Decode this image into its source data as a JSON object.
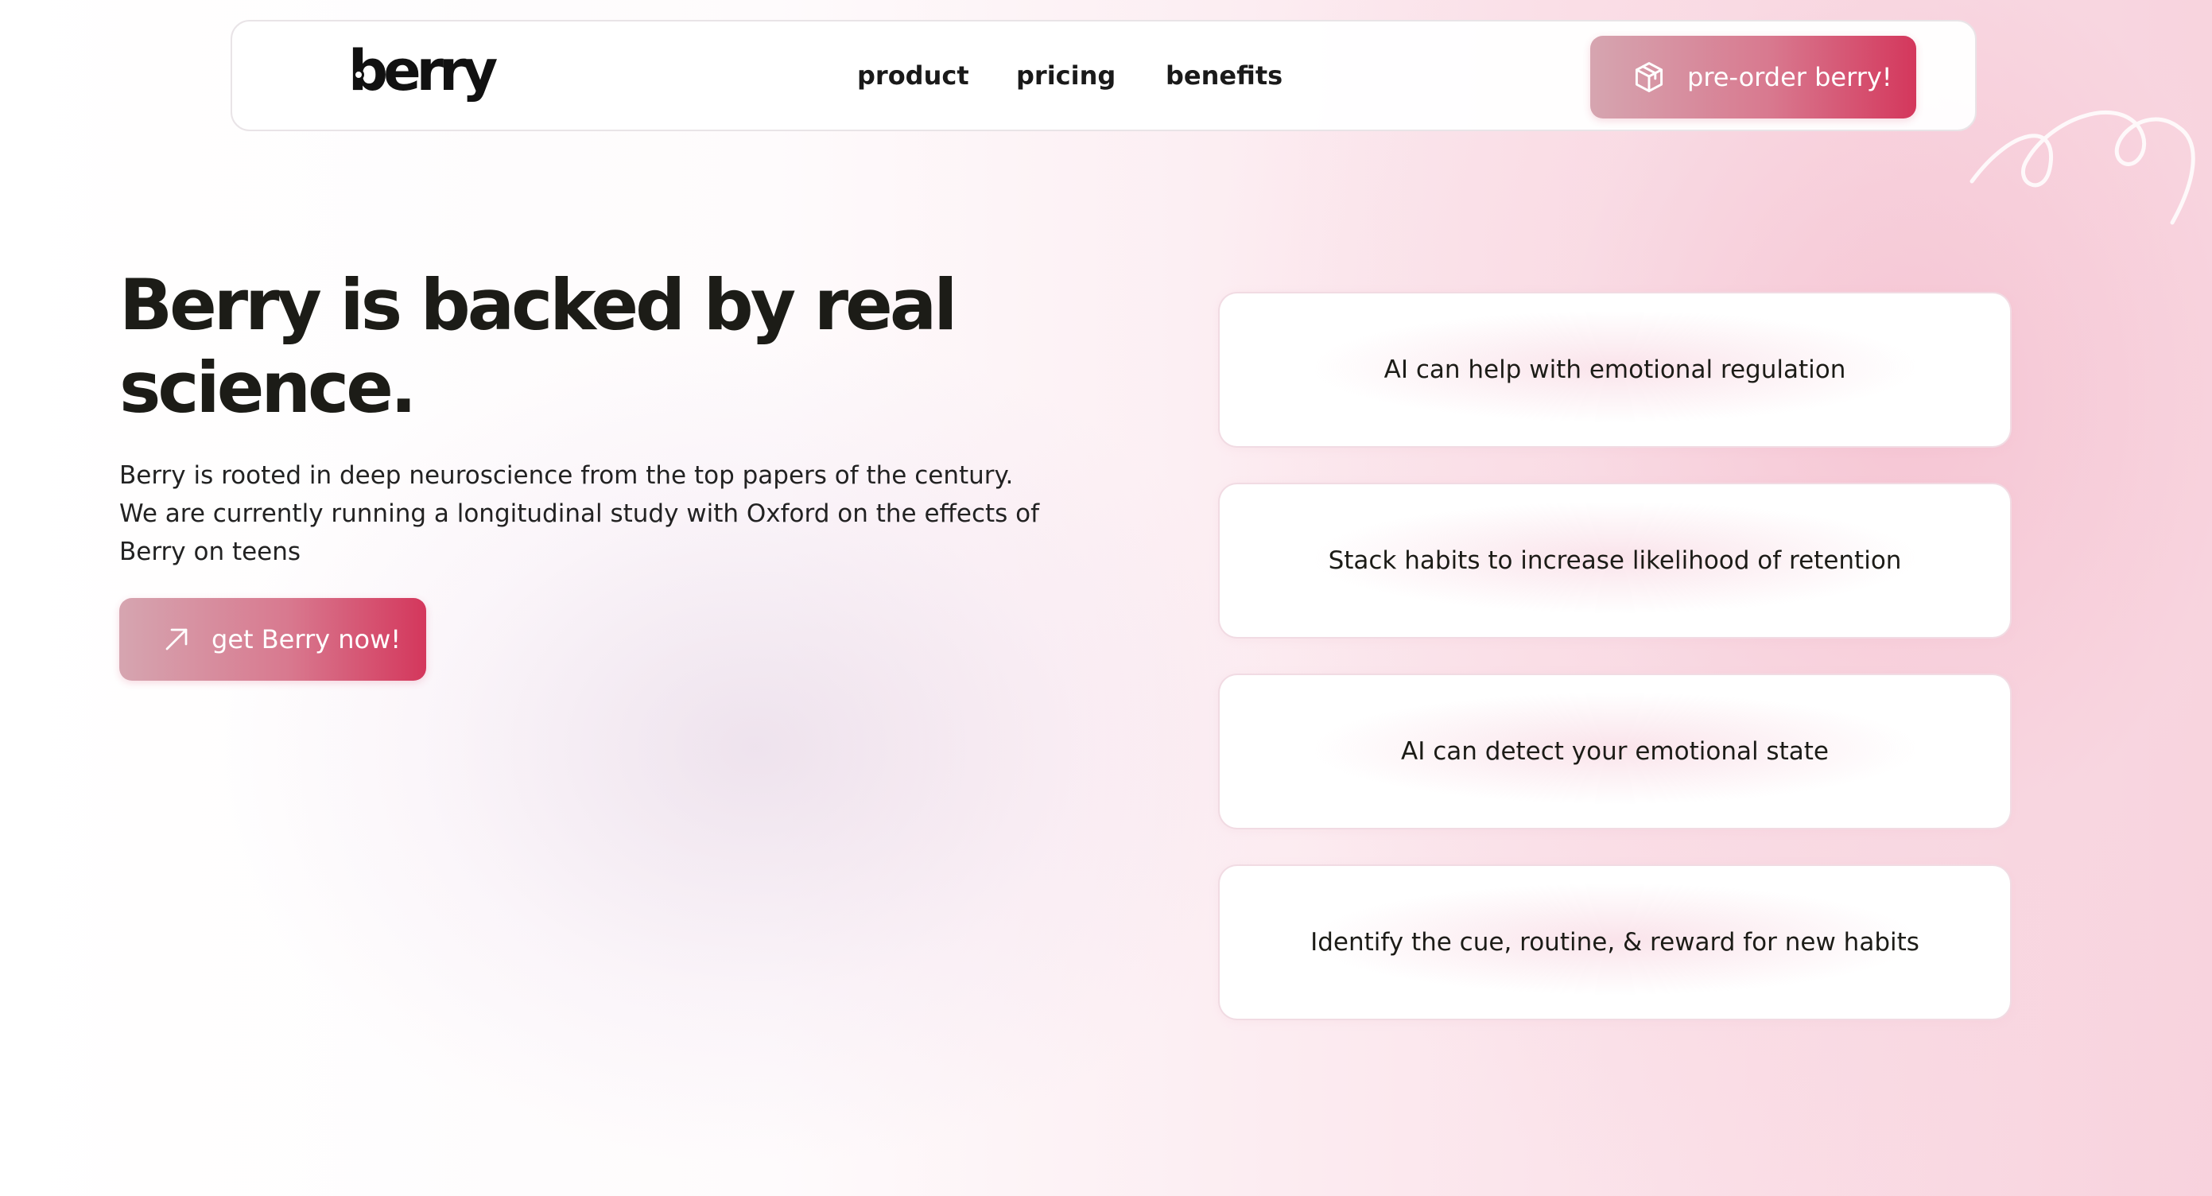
{
  "navbar": {
    "logo": "berry",
    "links": [
      {
        "label": "product"
      },
      {
        "label": "pricing"
      },
      {
        "label": "benefits"
      }
    ],
    "cta": {
      "label": "pre-order berry!",
      "icon": "package-icon"
    }
  },
  "hero": {
    "title": "Berry is backed by real science.",
    "description": "Berry is rooted in deep neuroscience from the top papers of the century. We are currently running a longitudinal study with Oxford on the effects of Berry on teens",
    "cta": {
      "label": "get Berry now!",
      "icon": "arrow-up-right-icon"
    }
  },
  "cards": [
    {
      "text": "AI can help with emotional regulation"
    },
    {
      "text": "Stack habits to increase likelihood of retention"
    },
    {
      "text": "AI can detect your emotional state"
    },
    {
      "text": "Identify the cue, routine, & reward for new habits"
    }
  ],
  "colors": {
    "accent": "#d4375c",
    "accent_light": "#d6a5b0",
    "text": "#1c1c17"
  }
}
